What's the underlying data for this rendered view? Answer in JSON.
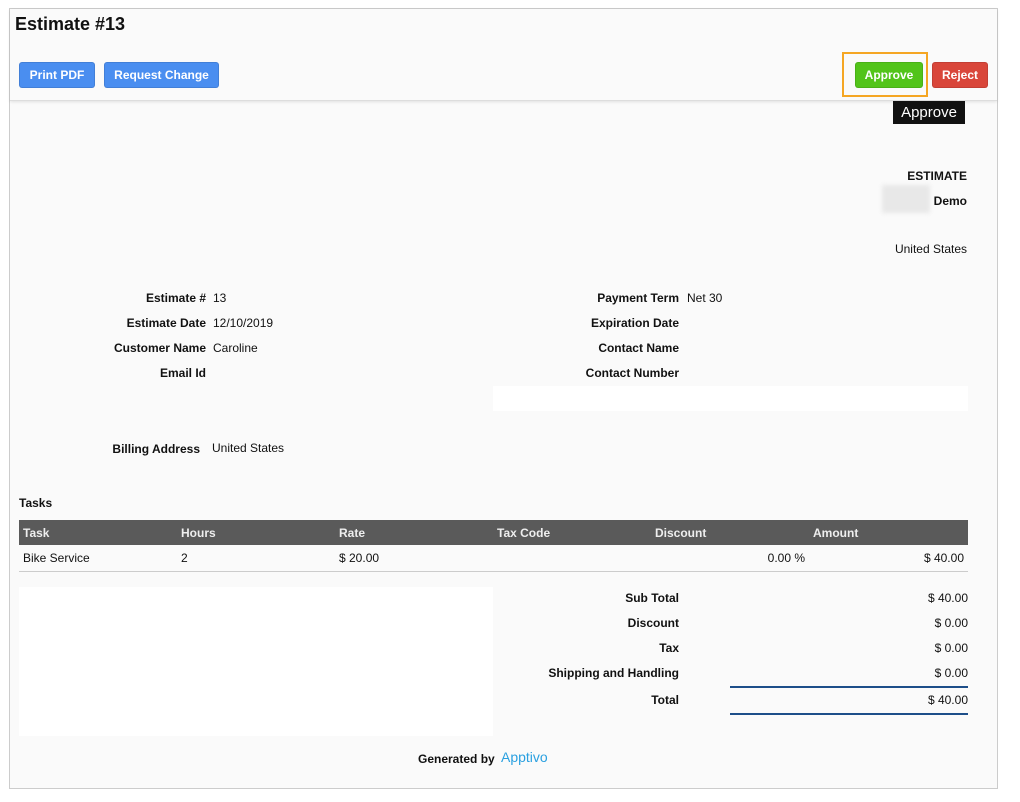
{
  "title": "Estimate #13",
  "buttons": {
    "print": "Print PDF",
    "request": "Request Change",
    "approve": "Approve",
    "reject": "Reject"
  },
  "tooltip": "Approve",
  "company": {
    "heading": "ESTIMATE",
    "name": "Demo",
    "country": "United States"
  },
  "left_fields": [
    {
      "label": "Estimate #",
      "value": "13"
    },
    {
      "label": "Estimate Date",
      "value": "12/10/2019"
    },
    {
      "label": "Customer Name",
      "value": "Caroline"
    },
    {
      "label": "Email Id",
      "value": ""
    }
  ],
  "right_fields": [
    {
      "label": "Payment Term",
      "value": "Net 30"
    },
    {
      "label": "Expiration Date",
      "value": ""
    },
    {
      "label": "Contact Name",
      "value": ""
    },
    {
      "label": "Contact Number",
      "value": ""
    }
  ],
  "billing": {
    "label": "Billing Address",
    "value": "United States"
  },
  "tasks": {
    "heading": "Tasks",
    "columns": [
      "Task",
      "Hours",
      "Rate",
      "Tax Code",
      "Discount",
      "Amount"
    ],
    "rows": [
      [
        "Bike Service",
        "2",
        "$ 20.00",
        "",
        "0.00 %",
        "$ 40.00"
      ]
    ]
  },
  "totals": [
    {
      "label": "Sub Total",
      "value": "$ 40.00"
    },
    {
      "label": "Discount",
      "value": "$ 0.00"
    },
    {
      "label": "Tax",
      "value": "$ 0.00"
    },
    {
      "label": "Shipping and Handling",
      "value": "$ 0.00"
    },
    {
      "label": "Total",
      "value": "$ 40.00"
    }
  ],
  "footer": {
    "generated": "Generated by",
    "brand": "Apptivo"
  },
  "colors": {
    "approve": "#52c41a",
    "reject": "#d9463a",
    "primary": "#4a8ef0",
    "highlight": "#f5a623"
  }
}
